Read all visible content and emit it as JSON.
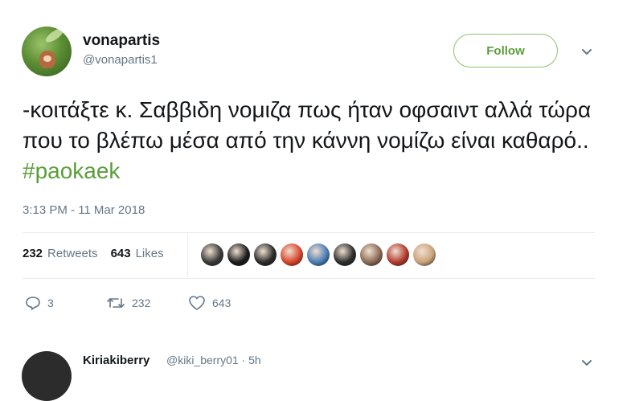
{
  "tweet": {
    "display_name": "vonapartis",
    "handle": "@vonapartis1",
    "follow_label": "Follow",
    "text": "-κοιτάξτε κ. Σαββιδη νομιζα πως ήταν οφσαιντ αλλά τώρα που το βλέπω μέσα από την κάννη νομίζω είναι καθαρό..",
    "hashtag": "#paokaek",
    "timestamp": "3:13 PM - 11 Mar 2018",
    "retweets_count": "232",
    "retweets_label": "Retweets",
    "likes_count": "643",
    "likes_label": "Likes",
    "likers": [
      {
        "name": "liker-1",
        "color": "#3a3a3a"
      },
      {
        "name": "liker-2",
        "color": "#1b1b1b"
      },
      {
        "name": "liker-3",
        "color": "#2a2a2a"
      },
      {
        "name": "liker-4",
        "color": "#d8452a"
      },
      {
        "name": "liker-5",
        "color": "#4b7cb5"
      },
      {
        "name": "liker-6",
        "color": "#2d2d2d"
      },
      {
        "name": "liker-7",
        "color": "#8a6a55"
      },
      {
        "name": "liker-8",
        "color": "#b23a2e"
      },
      {
        "name": "liker-9",
        "color": "#c9a27a"
      }
    ],
    "actions": {
      "reply_count": "3",
      "retweet_count": "232",
      "like_count": "643"
    }
  },
  "next_tweet": {
    "display_name": "Kiriakiberry",
    "handle_time": "@kiki_berry01 · 5h"
  },
  "colors": {
    "accent_green": "#5a9e3a",
    "muted_text": "#657786"
  }
}
